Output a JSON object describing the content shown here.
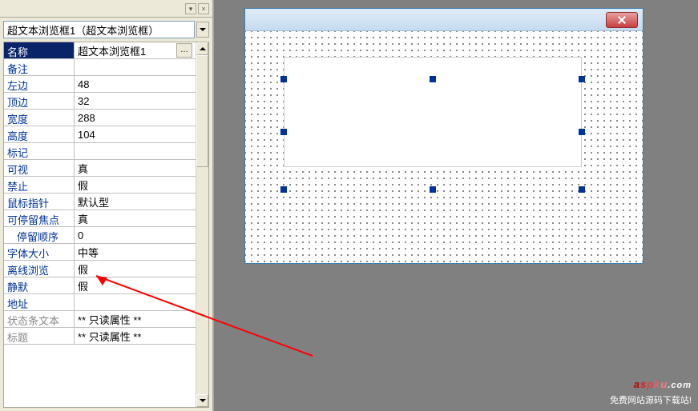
{
  "selector": {
    "text": "超文本浏览框1（超文本浏览框）"
  },
  "properties": [
    {
      "label": "名称",
      "value": "超文本浏览框1",
      "selected": true,
      "more": true
    },
    {
      "label": "备注",
      "value": ""
    },
    {
      "label": "左边",
      "value": "48"
    },
    {
      "label": "顶边",
      "value": "32"
    },
    {
      "label": "宽度",
      "value": "288"
    },
    {
      "label": "高度",
      "value": "104"
    },
    {
      "label": "标记",
      "value": ""
    },
    {
      "label": "可视",
      "value": "真"
    },
    {
      "label": "禁止",
      "value": "假"
    },
    {
      "label": "鼠标指针",
      "value": "默认型"
    },
    {
      "label": "可停留焦点",
      "value": "真"
    },
    {
      "label": "停留顺序",
      "value": "0",
      "indent": true
    },
    {
      "label": "字体大小",
      "value": "中等"
    },
    {
      "label": "离线浏览",
      "value": "假"
    },
    {
      "label": "静默",
      "value": "假"
    },
    {
      "label": "地址",
      "value": ""
    },
    {
      "label": "状态条文本",
      "value": "** 只读属性 **",
      "readonly": true
    },
    {
      "label": "标题",
      "value": "** 只读属性 **",
      "readonly": true
    }
  ],
  "watermark": {
    "brand": "aspku",
    "tld": ".com",
    "sub": "免费网站源码下载站!"
  }
}
